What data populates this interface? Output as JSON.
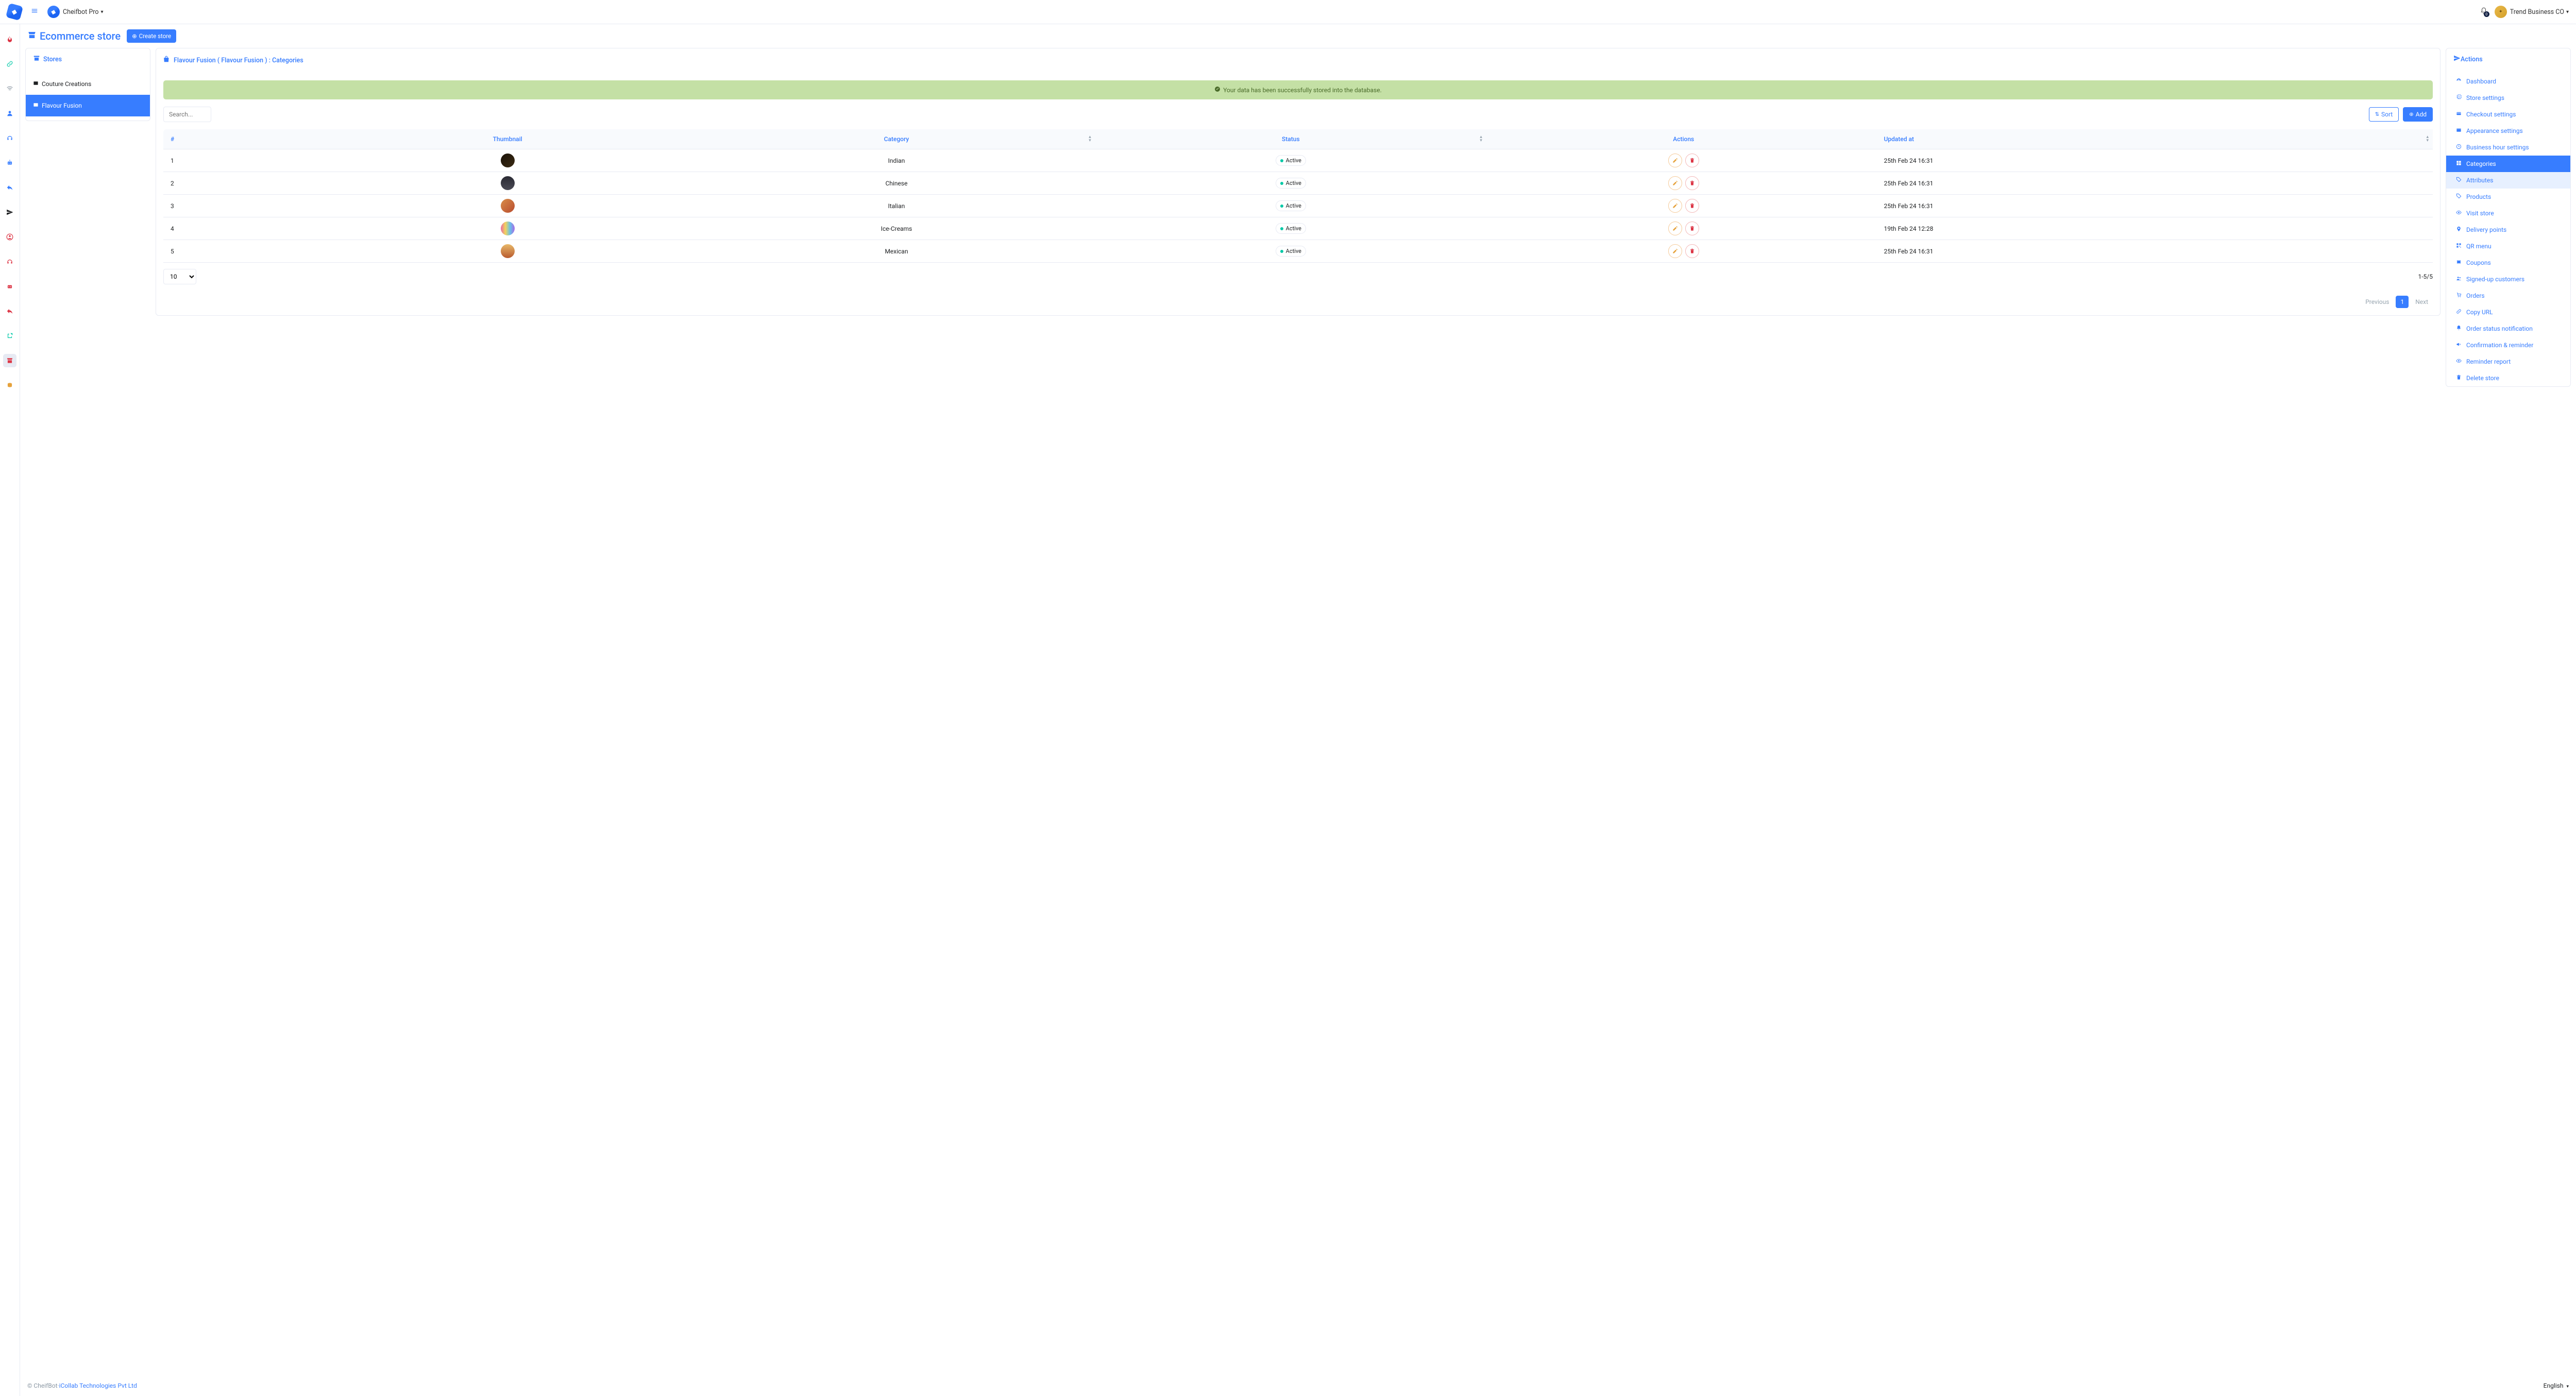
{
  "top": {
    "brand": "Cheifbot Pro",
    "notif_count": "0",
    "user_name": "Trend Business CO"
  },
  "page_title": "Ecommerce store",
  "create_store_btn": "Create store",
  "stores_header": "Stores",
  "stores": [
    {
      "name": "Couture Creations",
      "active": false
    },
    {
      "name": "Flavour Fusion",
      "active": true
    }
  ],
  "breadcrumb": {
    "store": "Flavour Fusion",
    "inner": "Flavour Fusion",
    "section": "Categories"
  },
  "alert_msg": "Your data has been successfully stored into the database.",
  "search_placeholder": "Search...",
  "btn_sort": "Sort",
  "btn_add": "Add",
  "table": {
    "headers": {
      "idx": "#",
      "thumb": "Thumbnail",
      "cat": "Category",
      "status": "Status",
      "actions": "Actions",
      "updated": "Updated at"
    },
    "rows": [
      {
        "idx": "1",
        "cat": "Indian",
        "status": "Active",
        "updated": "25th Feb 24 16:31",
        "thumb": "linear-gradient(135deg,#1a1208,#3b2a13)"
      },
      {
        "idx": "2",
        "cat": "Chinese",
        "status": "Active",
        "updated": "25th Feb 24 16:31",
        "thumb": "linear-gradient(180deg,#2a2a33,#4a4a55)"
      },
      {
        "idx": "3",
        "cat": "Italian",
        "status": "Active",
        "updated": "25th Feb 24 16:31",
        "thumb": "linear-gradient(135deg,#d98e4a,#b84b2e)"
      },
      {
        "idx": "4",
        "cat": "Ice-Creams",
        "status": "Active",
        "updated": "19th Feb 24 12:28",
        "thumb": "linear-gradient(90deg,#e86aa6,#f2d35b,#6ac0e8,#a56ae8)"
      },
      {
        "idx": "5",
        "cat": "Mexican",
        "status": "Active",
        "updated": "25th Feb 24 16:31",
        "thumb": "linear-gradient(180deg,#e8b86a,#b85a2e)"
      }
    ]
  },
  "per_page": "10",
  "range": "1-5/5",
  "pager": {
    "prev": "Previous",
    "cur": "1",
    "next": "Next"
  },
  "actions_header": "Actions",
  "actions": [
    {
      "label": "Dashboard"
    },
    {
      "label": "Store settings"
    },
    {
      "label": "Checkout settings"
    },
    {
      "label": "Appearance settings"
    },
    {
      "label": "Business hour settings"
    },
    {
      "label": "Categories",
      "active": true
    },
    {
      "label": "Attributes",
      "sub": true
    },
    {
      "label": "Products"
    },
    {
      "label": "Visit store"
    },
    {
      "label": "Delivery points"
    },
    {
      "label": "QR menu"
    },
    {
      "label": "Coupons"
    },
    {
      "label": "Signed-up customers"
    },
    {
      "label": "Orders"
    },
    {
      "label": "Copy URL"
    },
    {
      "label": "Order status notification"
    },
    {
      "label": "Confirmation & reminder"
    },
    {
      "label": "Reminder report"
    },
    {
      "label": "Delete store"
    }
  ],
  "action_icons": [
    "gauge-icon",
    "gear-icon",
    "credit-card-icon",
    "window-icon",
    "clock-icon",
    "grid-icon",
    "tag-icon",
    "tag-icon",
    "eye-icon",
    "pin-icon",
    "qrcode-icon",
    "ticket-icon",
    "users-icon",
    "cart-icon",
    "link-icon",
    "bell-icon",
    "megaphone-icon",
    "eye-icon",
    "trash-icon"
  ],
  "rail_items": [
    {
      "name": "fire-icon",
      "color": "#dc3545"
    },
    {
      "name": "link-icon",
      "color": "#00c9a7"
    },
    {
      "name": "wifi-icon",
      "color": "#8c98a4"
    },
    {
      "name": "user-icon",
      "color": "#377dff"
    },
    {
      "name": "headset-icon",
      "color": "#377dff"
    },
    {
      "name": "robot-icon",
      "color": "#377dff"
    },
    {
      "name": "reply-icon",
      "color": "#377dff"
    },
    {
      "name": "send-icon",
      "color": "#1e2022"
    },
    {
      "name": "user-circle-icon",
      "color": "#dc3545"
    },
    {
      "name": "headset2-icon",
      "color": "#dc3545"
    },
    {
      "name": "robot2-icon",
      "color": "#dc3545"
    },
    {
      "name": "reply2-icon",
      "color": "#dc3545"
    },
    {
      "name": "external-icon",
      "color": "#00c9a7"
    },
    {
      "name": "store-icon",
      "color": "#dc3545",
      "active": true
    },
    {
      "name": "coins-icon",
      "color": "#e6a23c"
    }
  ],
  "footer": {
    "copyright": "© CheifBot",
    "sep": " · ",
    "company": "iCollab Technologies Pvt Ltd",
    "lang": "English"
  }
}
